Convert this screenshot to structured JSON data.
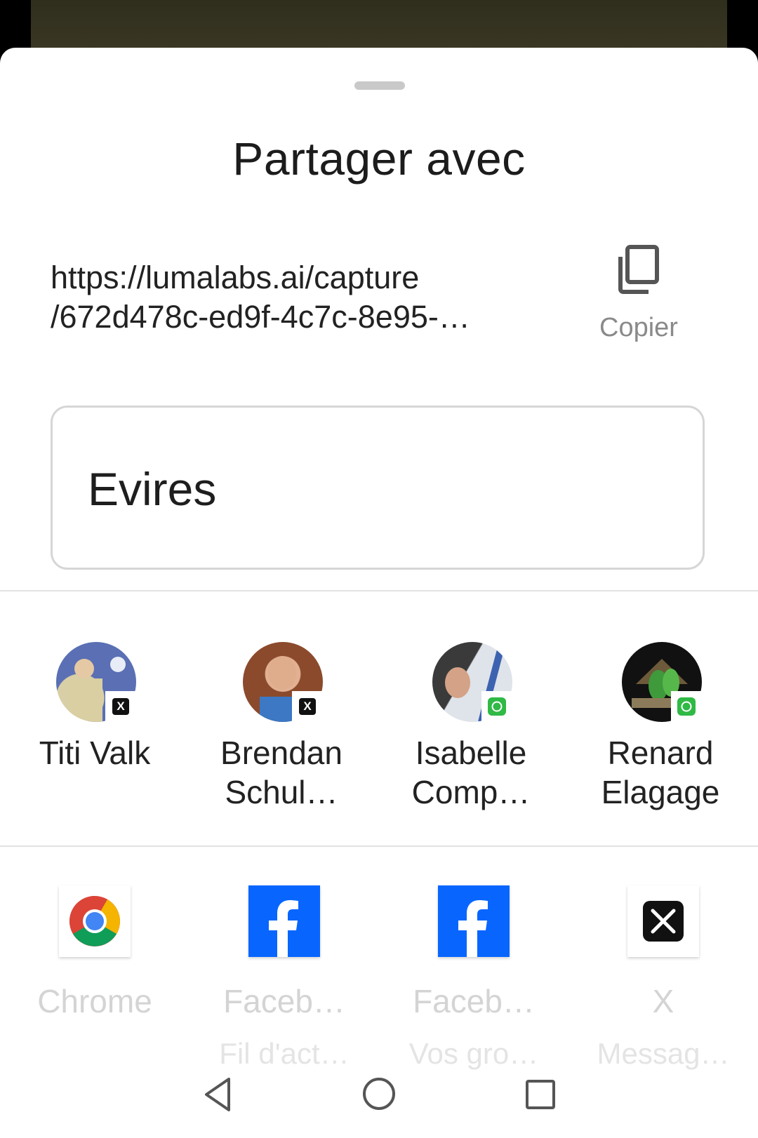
{
  "dialog": {
    "title": "Partager avec",
    "url_line1": "https://lumalabs.ai/capture",
    "url_line2": "/672d478c-ed9f-4c7c-8e95-…",
    "copy_label": "Copier",
    "text_value": "Evires"
  },
  "contacts": [
    {
      "name_line1": "Titi Valk",
      "name_line2": "",
      "app_badge": "x-icon"
    },
    {
      "name_line1": "Brendan",
      "name_line2": "Schul…",
      "app_badge": "x-icon"
    },
    {
      "name_line1": "Isabelle",
      "name_line2": "Comp…",
      "app_badge": "whatsapp-icon"
    },
    {
      "name_line1": "Renard",
      "name_line2": "Elagage",
      "app_badge": "whatsapp-icon"
    }
  ],
  "apps": [
    {
      "name": "Chrome",
      "sub": "",
      "icon": "chrome-icon"
    },
    {
      "name": "Faceb…",
      "sub": "Fil d'act…",
      "icon": "facebook-icon"
    },
    {
      "name": "Faceb…",
      "sub": "Vos gro…",
      "icon": "facebook-icon"
    },
    {
      "name": "X",
      "sub": "Messag…",
      "icon": "x-icon"
    }
  ],
  "colors": {
    "facebook_blue": "#0866ff",
    "whatsapp_green": "#2fb945",
    "x_black": "#111111"
  }
}
